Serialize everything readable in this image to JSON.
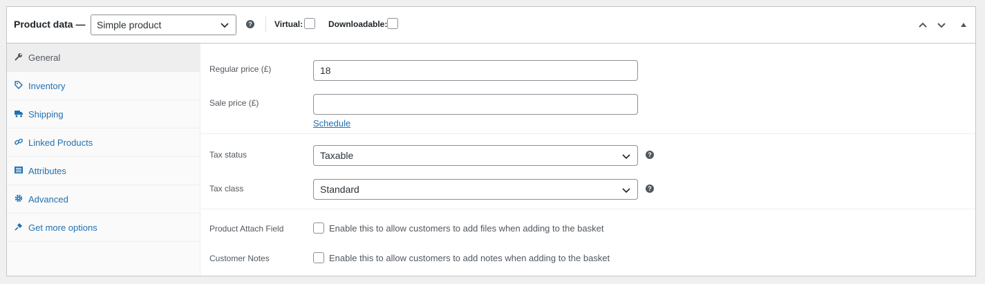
{
  "header": {
    "title": "Product data —",
    "product_type": "Simple product",
    "virtual_label": "Virtual:",
    "downloadable_label": "Downloadable:"
  },
  "tabs": [
    {
      "label": "General",
      "icon": "wrench-icon"
    },
    {
      "label": "Inventory",
      "icon": "tag-icon"
    },
    {
      "label": "Shipping",
      "icon": "truck-icon"
    },
    {
      "label": "Linked Products",
      "icon": "link-icon"
    },
    {
      "label": "Attributes",
      "icon": "list-icon"
    },
    {
      "label": "Advanced",
      "icon": "gear-icon"
    },
    {
      "label": "Get more options",
      "icon": "plugin-icon"
    }
  ],
  "general": {
    "regular_price_label": "Regular price (£)",
    "regular_price_value": "18",
    "sale_price_label": "Sale price (£)",
    "sale_price_value": "",
    "schedule_link": "Schedule",
    "tax_status_label": "Tax status",
    "tax_status_value": "Taxable",
    "tax_class_label": "Tax class",
    "tax_class_value": "Standard",
    "attach_label": "Product Attach Field",
    "attach_text": "Enable this to allow customers to add files when adding to the basket",
    "notes_label": "Customer Notes",
    "notes_text": "Enable this to allow customers to add notes when adding to the basket"
  },
  "colors": {
    "link": "#2271b1",
    "active_tab_bg": "#eeeeee",
    "border": "#c3c4c7"
  }
}
